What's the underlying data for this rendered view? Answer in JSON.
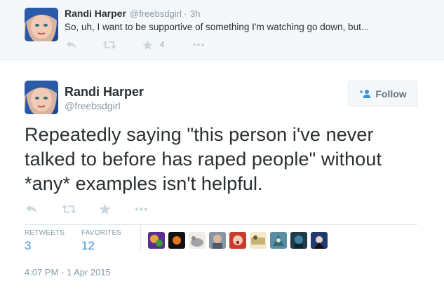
{
  "parent_tweet": {
    "name": "Randi Harper",
    "handle": "@freebsdgirl",
    "separator": "·",
    "time": "3h",
    "text": "So, uh, I want to be supportive of something I'm watching go down, but...",
    "favorite_count": "4",
    "actions": [
      "reply-icon",
      "retweet-icon",
      "favorite-icon",
      "more-icon"
    ]
  },
  "main_tweet": {
    "name": "Randi Harper",
    "handle": "@freebsdgirl",
    "follow_label": "Follow",
    "text_lines": [
      "Repeatedly saying \"this person i've never",
      "talked to before has raped people\" without",
      "*any* examples isn't helpful."
    ],
    "actions": [
      "reply-icon",
      "retweet-icon",
      "favorite-icon",
      "more-icon"
    ],
    "stats": {
      "retweets_label": "RETWEETS",
      "retweets_value": "3",
      "favorites_label": "FAVORITES",
      "favorites_value": "12"
    },
    "timestamp": "4:07 PM - 1 Apr 2015"
  },
  "colors": {
    "name": "#292f33",
    "muted": "#8899a6",
    "icon": "#ccd6dd",
    "stat_value": "#3b94d9",
    "parent_bg": "#f5f8fa",
    "border": "#e1e8ed"
  }
}
